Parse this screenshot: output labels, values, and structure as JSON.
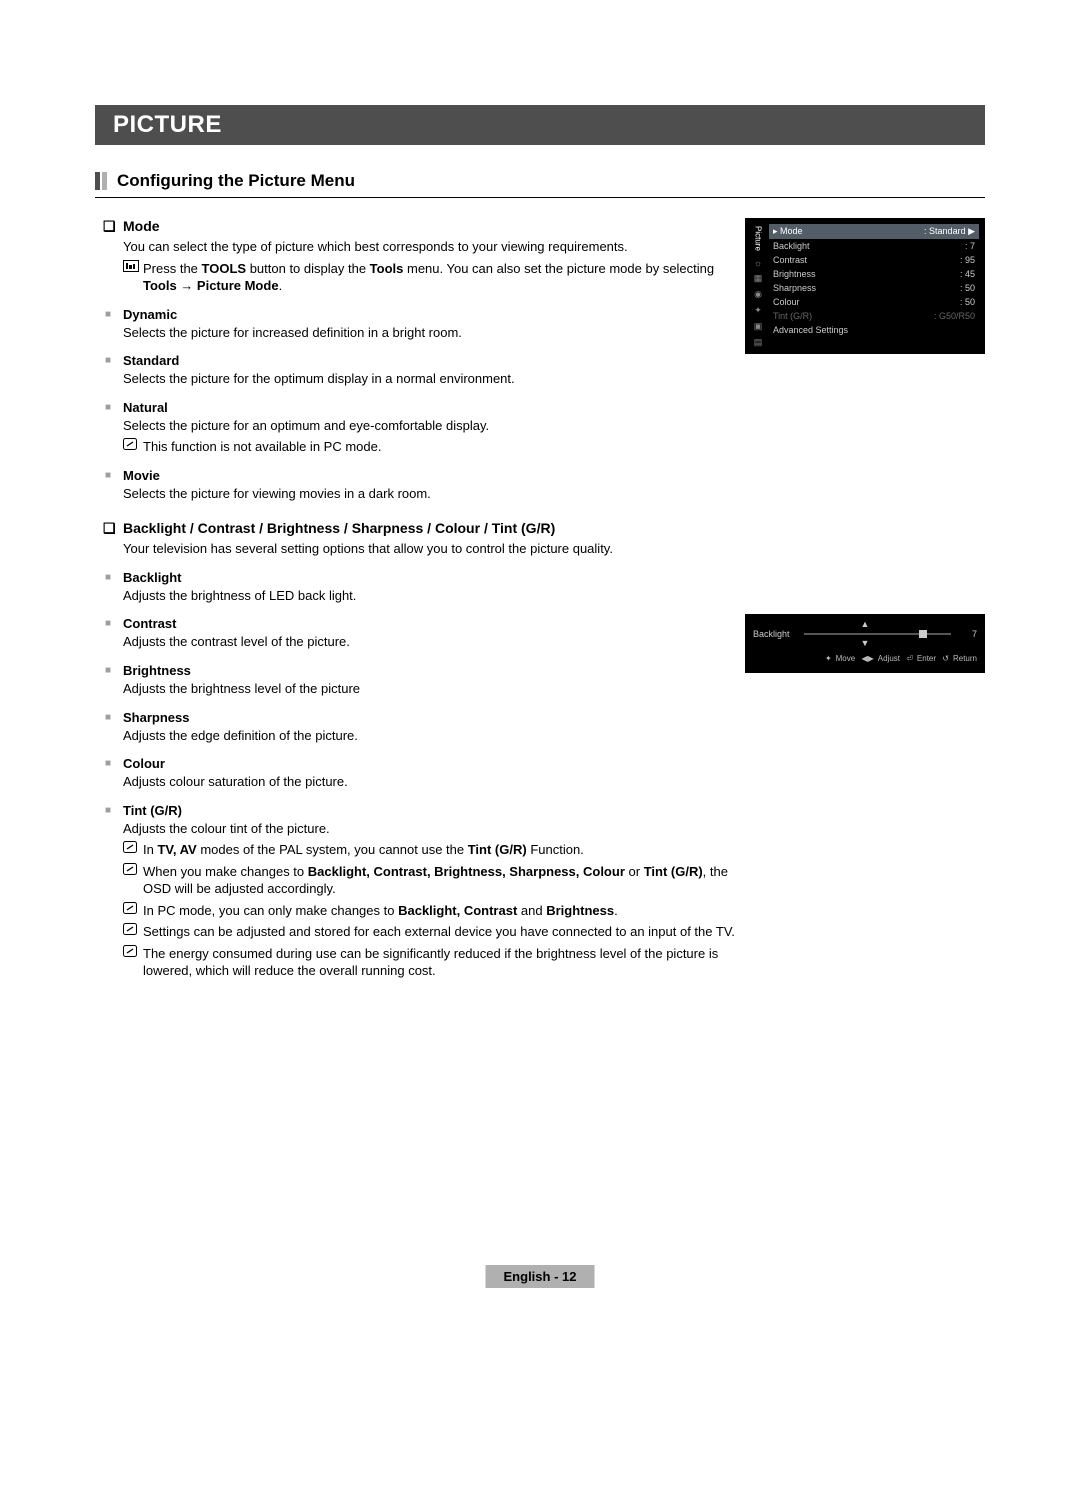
{
  "chapterTitle": "PICTURE",
  "sectionTitle": "Configuring the Picture Menu",
  "mode": {
    "heading": "Mode",
    "intro": "You can select the type of picture which best corresponds to your viewing requirements.",
    "toolTip": {
      "pre": "Press the ",
      "toolsBtn": "TOOLS",
      "mid": " button to display the ",
      "toolsMenu": "Tools",
      "post": " menu. You can also set the picture mode by selecting ",
      "path": "Tools → Picture Mode",
      "end": "."
    },
    "items": [
      {
        "name": "Dynamic",
        "desc": "Selects the picture for increased definition in a bright room."
      },
      {
        "name": "Standard",
        "desc": "Selects the picture for the optimum display in a normal environment."
      },
      {
        "name": "Natural",
        "desc": "Selects the picture for an optimum and eye-comfortable display.",
        "note": "This function is not available in PC mode."
      },
      {
        "name": "Movie",
        "desc": "Selects the picture for viewing movies in a dark room."
      }
    ]
  },
  "adjust": {
    "heading": "Backlight / Contrast / Brightness / Sharpness / Colour / Tint (G/R)",
    "intro": "Your television has several setting options that allow you to control the picture quality.",
    "items": [
      {
        "name": "Backlight",
        "desc": "Adjusts the brightness of LED back light."
      },
      {
        "name": "Contrast",
        "desc": "Adjusts the contrast level of the picture."
      },
      {
        "name": "Brightness",
        "desc": "Adjusts the brightness level of the picture"
      },
      {
        "name": "Sharpness",
        "desc": "Adjusts the edge definition of the picture."
      },
      {
        "name": "Colour",
        "desc": "Adjusts colour saturation of the picture."
      }
    ],
    "tint": {
      "name": "Tint (G/R)",
      "desc": "Adjusts the colour tint of the picture."
    },
    "notes": {
      "n1a": "In ",
      "n1b": "TV, AV",
      "n1c": " modes of the PAL system, you cannot use the ",
      "n1d": "Tint (G/R)",
      "n1e": " Function.",
      "n2a": "When you make changes to ",
      "n2b": "Backlight, Contrast, Brightness, Sharpness, Colour",
      "n2c": " or ",
      "n2d": "Tint (G/R)",
      "n2e": ", the OSD will be adjusted accordingly.",
      "n3a": "In PC mode, you can only make changes to ",
      "n3b": "Backlight, Contrast",
      "n3c": " and ",
      "n3d": "Brightness",
      "n3e": ".",
      "n4": "Settings can be adjusted and stored for each external device you have connected to an input of the TV.",
      "n5": "The energy consumed during use can be significantly reduced if the brightness level of the picture is lowered, which will reduce the overall running cost."
    }
  },
  "osdMenu": {
    "tab": "Picture",
    "modeLabel": "Mode",
    "modeValue": ": Standard",
    "rows": [
      {
        "k": "Backlight",
        "v": ": 7"
      },
      {
        "k": "Contrast",
        "v": ": 95"
      },
      {
        "k": "Brightness",
        "v": ": 45"
      },
      {
        "k": "Sharpness",
        "v": ": 50"
      },
      {
        "k": "Colour",
        "v": ": 50"
      }
    ],
    "tintRow": {
      "k": "Tint (G/R)",
      "v": ": G50/R50"
    },
    "advanced": "Advanced Settings"
  },
  "osdSlider": {
    "label": "Backlight",
    "value": "7",
    "hints": {
      "move": "Move",
      "adjust": "Adjust",
      "enter": "Enter",
      "ret": "Return"
    }
  },
  "footer": "English - 12"
}
